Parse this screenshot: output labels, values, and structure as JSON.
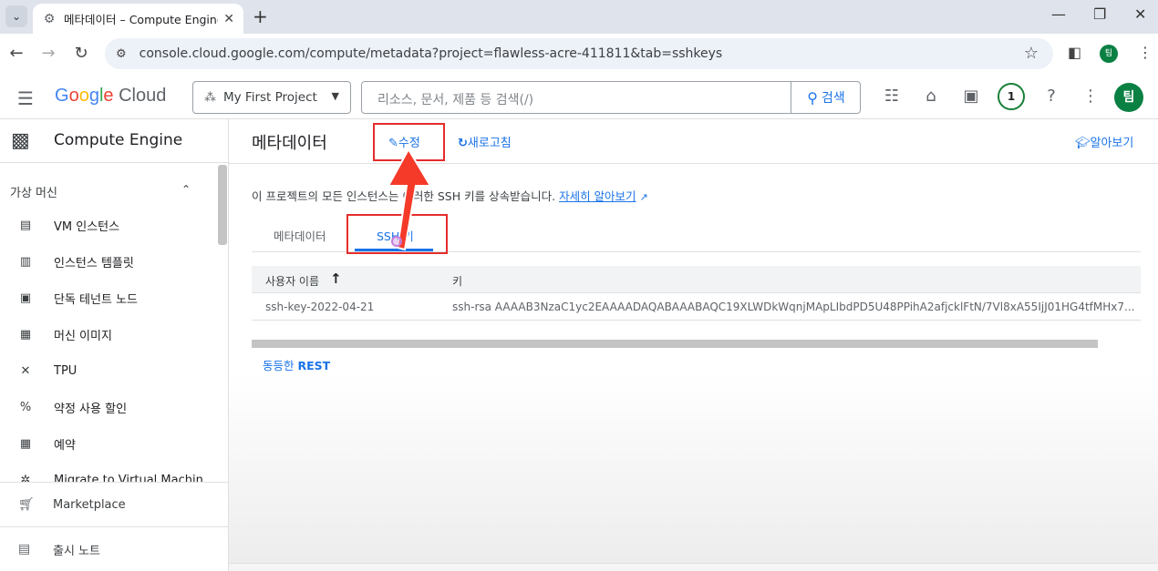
{
  "browser": {
    "tab_title": "메타데이터 – Compute Engine",
    "url": "console.cloud.google.com/compute/metadata?project=flawless-acre-411811&tab=sshkeys",
    "profile_initial": "팀"
  },
  "header": {
    "logo_google": [
      "G",
      "o",
      "o",
      "g",
      "l",
      "e"
    ],
    "logo_cloud": "Cloud",
    "project_name": "My First Project",
    "search_placeholder": "리소스, 문서, 제품 등 검색(/)",
    "search_button": "검색",
    "notification_count": "1",
    "avatar_initial": "팀"
  },
  "sidebar": {
    "product": "Compute Engine",
    "section": "가상 머신",
    "items": [
      {
        "label": "VM 인스턴스",
        "icon": "▤"
      },
      {
        "label": "인스턴스 템플릿",
        "icon": "▥"
      },
      {
        "label": "단독 테넌트 노드",
        "icon": "▣"
      },
      {
        "label": "머신 이미지",
        "icon": "▦"
      },
      {
        "label": "TPU",
        "icon": "✕"
      },
      {
        "label": "약정 사용 할인",
        "icon": "%"
      },
      {
        "label": "예약",
        "icon": "▦"
      },
      {
        "label": "Migrate to Virtual Machin",
        "icon": "✲"
      }
    ],
    "marketplace": "Marketplace",
    "release_notes": "출시 노트"
  },
  "main": {
    "title": "메타데이터",
    "edit": "수정",
    "refresh": "새로고침",
    "learn": "알아보기",
    "info_text": "이 프로젝트의 모든 인스턴스는 이러한 SSH 키를 상속받습니다.",
    "info_link": "자세히 알아보기",
    "tabs": [
      "메타데이터",
      "SSH 키"
    ],
    "table": {
      "headers": [
        "사용자 이름",
        "키"
      ],
      "rows": [
        [
          "ssh-key-2022-04-21",
          "ssh-rsa AAAAB3NzaC1yc2EAAAADAQABAAABAQC19XLWDkWqnjMApLIbdPD5U48PPihA2afjcklFtN/7Vl8xA55IjJ01HG4tfMHx7..."
        ]
      ]
    },
    "rest_prefix": "동등한",
    "rest_label": "REST"
  },
  "colors": {
    "accent": "#1a73e8",
    "highlight": "#e52d2d"
  }
}
